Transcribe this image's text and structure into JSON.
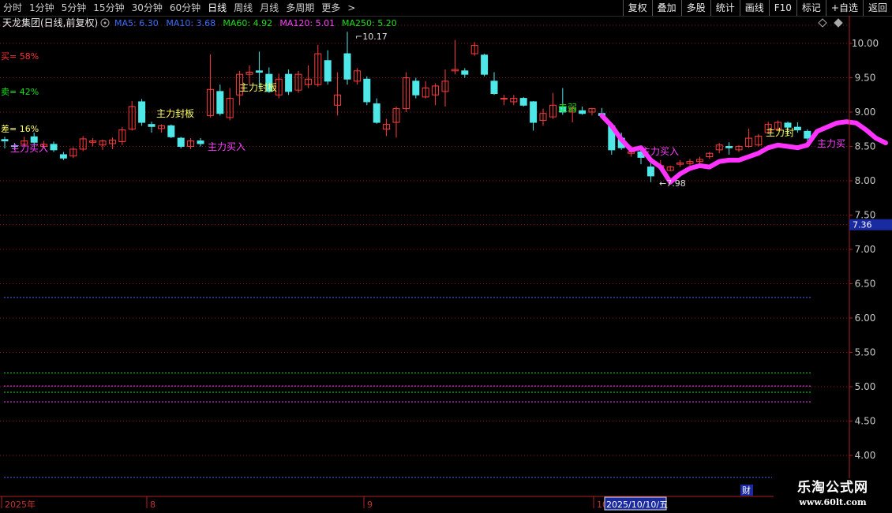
{
  "toolbar": {
    "timeframes": [
      "分时",
      "1分钟",
      "5分钟",
      "15分钟",
      "30分钟",
      "60分钟",
      "日线",
      "周线",
      "月线",
      "多周期",
      "更多"
    ],
    "active": "日线",
    "more_arrow": ">",
    "right_buttons": [
      "复权",
      "叠加",
      "多股",
      "统计",
      "画线",
      "F10",
      "+自选",
      "返回"
    ],
    "mark_button": "标记"
  },
  "header": {
    "stock_name": "天龙集团(日线,前复权)",
    "gear_icon": "gear-icon",
    "ma": [
      {
        "label": "MA5: 6.30",
        "color": "#3b6cff"
      },
      {
        "label": "MA10: 3.68",
        "color": "#3b6cff"
      },
      {
        "label": "MA60: 4.92",
        "color": "#19e019"
      },
      {
        "label": "MA120: 5.01",
        "color": "#ff40ff"
      },
      {
        "label": "MA250: 5.20",
        "color": "#19e019"
      }
    ],
    "diamond_icons": [
      "diamond-icon",
      "diamond-icon"
    ]
  },
  "left_stats": [
    {
      "text": "买= 58%",
      "color": "#ff3030"
    },
    {
      "text": "卖= 42%",
      "color": "#19e019"
    },
    {
      "text": "差= 16%",
      "color": "#ffff60"
    }
  ],
  "annotations": {
    "high": "10.17",
    "low": "7.98",
    "zlmr_1": "主力买入",
    "zlfb_1": "主力封板",
    "zlmr_2": "主力买入",
    "zlfb_2": "主力封板",
    "zr": "走弱",
    "zlmr_3": "主力买入",
    "zlfb_3": "主力封",
    "zlmr_4": "主力买"
  },
  "price_axis": {
    "ticks": [
      "10.00",
      "9.50",
      "9.00",
      "8.50",
      "8.00",
      "7.50",
      "7.00",
      "6.50",
      "6.00",
      "5.50",
      "5.00",
      "4.50",
      "4.00"
    ],
    "current": "7.36"
  },
  "date_axis": {
    "labels": [
      "2025年",
      "8",
      "9",
      "10"
    ],
    "cursor_date": "2025/10/10/五",
    "fin_badge": "财"
  },
  "watermark": {
    "line1": "乐淘公式网",
    "line2": "www.60lt.com"
  },
  "colors": {
    "up": "#ff3b3b",
    "down": "#4fe8e8",
    "trend": "#ff33ff",
    "grid": "#8a1a1a",
    "axis": "#b02020"
  },
  "chart_data": {
    "type": "candlestick",
    "candles": [
      [
        8.6,
        8.58,
        8.64,
        8.47
      ],
      [
        8.51,
        8.5,
        8.55,
        8.45
      ],
      [
        8.53,
        8.58,
        8.64,
        8.5
      ],
      [
        8.64,
        8.56,
        8.7,
        8.5
      ],
      [
        8.5,
        8.53,
        8.58,
        8.47
      ],
      [
        8.53,
        8.45,
        8.57,
        8.42
      ],
      [
        8.38,
        8.33,
        8.42,
        8.3
      ],
      [
        8.36,
        8.46,
        8.49,
        8.33
      ],
      [
        8.46,
        8.61,
        8.65,
        8.43
      ],
      [
        8.56,
        8.58,
        8.62,
        8.5
      ],
      [
        8.52,
        8.58,
        8.6,
        8.45
      ],
      [
        8.54,
        8.59,
        8.63,
        8.46
      ],
      [
        8.57,
        8.74,
        8.78,
        8.52
      ],
      [
        8.75,
        9.08,
        9.16,
        8.73
      ],
      [
        9.15,
        8.85,
        9.19,
        8.8
      ],
      [
        8.82,
        8.79,
        8.86,
        8.7
      ],
      [
        8.76,
        8.8,
        8.82,
        8.7
      ],
      [
        8.8,
        8.64,
        8.82,
        8.62
      ],
      [
        8.62,
        8.5,
        8.64,
        8.47
      ],
      [
        8.5,
        8.58,
        8.62,
        8.46
      ],
      [
        8.58,
        8.54,
        8.62,
        8.5
      ],
      [
        8.95,
        9.33,
        9.84,
        8.92
      ],
      [
        9.3,
        8.98,
        9.4,
        8.95
      ],
      [
        8.92,
        9.2,
        9.35,
        8.88
      ],
      [
        9.25,
        9.55,
        9.6,
        9.1
      ],
      [
        9.55,
        9.58,
        9.68,
        9.4
      ],
      [
        9.6,
        9.58,
        9.88,
        9.35
      ],
      [
        9.55,
        9.3,
        9.65,
        9.28
      ],
      [
        9.25,
        9.48,
        9.56,
        9.2
      ],
      [
        9.55,
        9.3,
        9.62,
        9.25
      ],
      [
        9.32,
        9.55,
        9.6,
        9.28
      ],
      [
        9.4,
        9.48,
        9.68,
        9.35
      ],
      [
        9.4,
        9.85,
        9.98,
        9.37
      ],
      [
        9.75,
        9.45,
        9.9,
        9.4
      ],
      [
        9.1,
        9.25,
        9.58,
        8.95
      ],
      [
        9.85,
        9.48,
        10.17,
        9.4
      ],
      [
        9.45,
        9.6,
        9.64,
        9.4
      ],
      [
        9.48,
        9.15,
        9.52,
        9.1
      ],
      [
        9.12,
        8.85,
        9.2,
        8.83
      ],
      [
        8.75,
        8.82,
        8.9,
        8.65
      ],
      [
        8.85,
        9.05,
        9.08,
        8.63
      ],
      [
        9.05,
        9.5,
        9.58,
        9.0
      ],
      [
        9.45,
        9.25,
        9.5,
        9.2
      ],
      [
        9.22,
        9.35,
        9.45,
        9.2
      ],
      [
        9.25,
        9.38,
        9.42,
        9.1
      ],
      [
        9.3,
        9.45,
        9.62,
        9.08
      ],
      [
        9.6,
        9.62,
        10.05,
        9.55
      ],
      [
        9.6,
        9.55,
        9.64,
        9.5
      ],
      [
        9.85,
        9.97,
        10.02,
        9.82
      ],
      [
        9.83,
        9.55,
        9.85,
        9.52
      ],
      [
        9.45,
        9.27,
        9.58,
        9.25
      ],
      [
        9.2,
        9.2,
        9.25,
        9.1
      ],
      [
        9.15,
        9.2,
        9.25,
        9.1
      ],
      [
        9.2,
        9.1,
        9.22,
        9.08
      ],
      [
        9.15,
        8.85,
        9.16,
        8.73
      ],
      [
        8.88,
        8.98,
        9.05,
        8.8
      ],
      [
        8.93,
        9.1,
        9.28,
        8.9
      ],
      [
        9.08,
        9.0,
        9.35,
        8.96
      ],
      [
        9.0,
        9.05,
        9.08,
        8.85
      ],
      [
        9.02,
        8.98,
        9.08,
        8.96
      ],
      [
        9.0,
        9.05,
        9.06,
        8.95
      ],
      [
        8.98,
        8.95,
        9.06,
        8.92
      ],
      [
        8.8,
        8.45,
        8.8,
        8.38
      ],
      [
        8.62,
        8.48,
        8.7,
        8.45
      ],
      [
        8.4,
        8.42,
        8.5,
        8.35
      ],
      [
        8.42,
        8.34,
        8.48,
        8.24
      ],
      [
        8.2,
        8.07,
        8.28,
        7.98
      ],
      [
        8.2,
        8.22,
        8.3,
        8.15
      ],
      [
        8.15,
        8.2,
        8.22,
        8.14
      ],
      [
        8.24,
        8.26,
        8.3,
        8.2
      ],
      [
        8.25,
        8.28,
        8.32,
        8.22
      ],
      [
        8.28,
        8.31,
        8.35,
        8.25
      ],
      [
        8.35,
        8.4,
        8.42,
        8.32
      ],
      [
        8.45,
        8.52,
        8.55,
        8.4
      ],
      [
        8.5,
        8.48,
        8.56,
        8.38
      ],
      [
        8.45,
        8.5,
        8.52,
        8.42
      ],
      [
        8.5,
        8.62,
        8.76,
        8.48
      ],
      [
        8.52,
        8.65,
        8.68,
        8.5
      ],
      [
        8.7,
        8.82,
        8.86,
        8.68
      ],
      [
        8.75,
        8.85,
        8.88,
        8.72
      ],
      [
        8.84,
        8.78,
        8.86,
        8.68
      ],
      [
        8.78,
        8.74,
        8.85,
        8.7
      ],
      [
        8.72,
        8.62,
        8.75,
        8.58
      ]
    ],
    "trend": [
      [
        8.95,
        8.8,
        8.6,
        8.45,
        8.48,
        8.3,
        8.2,
        7.98,
        8.1,
        8.18,
        8.22,
        8.2,
        8.28,
        8.3,
        8.3,
        8.35,
        8.4,
        8.48,
        8.52,
        8.5,
        8.48,
        8.52,
        8.72,
        8.78,
        8.84,
        8.86,
        8.84,
        8.74,
        8.62,
        8.55
      ]
    ],
    "hlines": [
      {
        "price": 6.3,
        "color": "#3b6cff"
      },
      {
        "price": 5.2,
        "color": "#19e019"
      },
      {
        "price": 5.01,
        "color": "#ff40ff"
      },
      {
        "price": 4.92,
        "color": "#19e019"
      },
      {
        "price": 4.78,
        "color": "#ff40ff"
      },
      {
        "price": 3.68,
        "color": "#3b6cff"
      }
    ],
    "ylim": [
      3.8,
      10.4
    ]
  }
}
